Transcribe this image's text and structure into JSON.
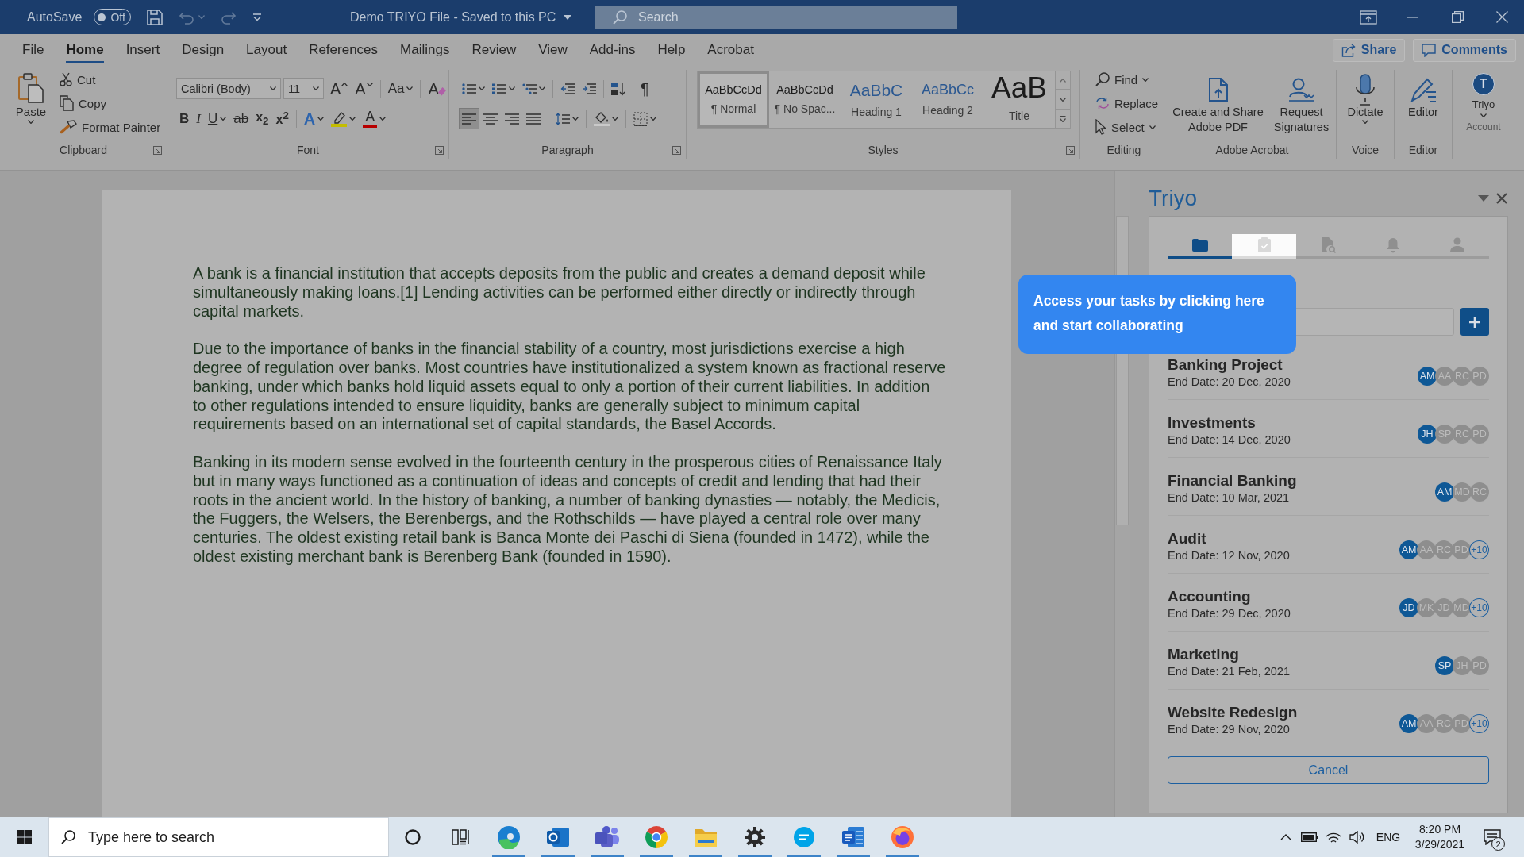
{
  "title_bar": {
    "autosave_label": "AutoSave",
    "autosave_toggle": {
      "on": false,
      "label": "Off"
    },
    "quick_access": [
      {
        "kind": "save",
        "disabled": false
      },
      {
        "kind": "undo",
        "disabled": true,
        "menu": true
      },
      {
        "kind": "redo",
        "disabled": true
      },
      {
        "kind": "customize",
        "disabled": false
      }
    ],
    "document_title": "Demo TRIYO File - Saved to this PC",
    "search": {
      "placeholder": "Search"
    }
  },
  "menu_tabs": [
    {
      "label": "File",
      "selected": false
    },
    {
      "label": "Home",
      "selected": true
    },
    {
      "label": "Insert",
      "selected": false
    },
    {
      "label": "Design",
      "selected": false
    },
    {
      "label": "Layout",
      "selected": false
    },
    {
      "label": "References",
      "selected": false
    },
    {
      "label": "Mailings",
      "selected": false
    },
    {
      "label": "Review",
      "selected": false
    },
    {
      "label": "View",
      "selected": false
    },
    {
      "label": "Add-ins",
      "selected": false
    },
    {
      "label": "Help",
      "selected": false
    },
    {
      "label": "Acrobat",
      "selected": false
    }
  ],
  "share_button": "Share",
  "comments_button": "Comments",
  "ribbon": {
    "groups": [
      {
        "kind": "clipboard",
        "label": "Clipboard",
        "launcher": true,
        "paste": {
          "label": "Paste",
          "menu": true
        },
        "commands": [
          "Cut",
          "Copy",
          "Format Painter"
        ]
      },
      {
        "kind": "font",
        "label": "Font",
        "launcher": true,
        "font_name": "Calibri (Body)",
        "font_size": "11",
        "tools": [
          {
            "kind": "grow",
            "glyph": "A"
          },
          {
            "kind": "shrink",
            "glyph": "A"
          },
          {
            "kind": "case",
            "glyph": "Aa",
            "menu": true
          },
          {
            "kind": "clear",
            "glyph": "A"
          }
        ],
        "formats": [
          {
            "kind": "bold",
            "glyph": "B"
          },
          {
            "kind": "italic",
            "glyph": "I"
          },
          {
            "kind": "underline",
            "glyph": "U",
            "menu": true
          },
          {
            "kind": "strike",
            "glyph": "ab"
          },
          {
            "kind": "subscript",
            "glyph": "x$_{2}$"
          },
          {
            "kind": "superscript",
            "glyph": "x$^{2}$"
          },
          {
            "kind": "effects",
            "glyph": "A",
            "menu": true
          },
          {
            "kind": "highlight",
            "menu": true,
            "color": "#c4bd00"
          },
          {
            "kind": "font_color",
            "glyph": "A",
            "menu": true,
            "color": "#b80000"
          }
        ]
      },
      {
        "kind": "paragraph",
        "label": "Paragraph",
        "launcher": true,
        "row1": [
          {
            "kind": "bullets",
            "menu": true
          },
          {
            "kind": "numbering",
            "menu": true
          },
          {
            "kind": "multilevel",
            "menu": true
          },
          {
            "kind": "decrease_indent"
          },
          {
            "kind": "increase_indent"
          },
          {
            "kind": "sort"
          },
          {
            "kind": "show_marks",
            "glyph": "¶"
          }
        ],
        "alignment": [
          {
            "kind": "align_left",
            "selected": true
          },
          {
            "kind": "align_center",
            "selected": false
          },
          {
            "kind": "align_right",
            "selected": false
          },
          {
            "kind": "align_justify",
            "selected": false
          }
        ],
        "row2": [
          {
            "kind": "line_spacing",
            "menu": true
          },
          {
            "kind": "shading",
            "menu": true
          },
          {
            "kind": "borders",
            "menu": true
          }
        ]
      },
      {
        "kind": "styles",
        "label": "Styles",
        "launcher": true,
        "gallery": [
          {
            "kind": "normal",
            "preview": "AaBbCcDd",
            "name": "¶ Normal",
            "selected": true
          },
          {
            "kind": "no_spacing",
            "preview": "AaBbCcDd",
            "name": "¶ No Spac...",
            "selected": false
          },
          {
            "kind": "heading1",
            "preview": "AaBbC",
            "name": "Heading 1",
            "selected": false
          },
          {
            "kind": "heading2",
            "preview": "AaBbCc",
            "name": "Heading 2",
            "selected": false
          },
          {
            "kind": "title",
            "preview": "AaB",
            "name": "Title",
            "selected": false
          }
        ]
      },
      {
        "kind": "editing",
        "label": "Editing",
        "commands": [
          {
            "kind": "find",
            "label": "Find",
            "menu": true
          },
          {
            "kind": "replace",
            "label": "Replace"
          },
          {
            "kind": "select",
            "label": "Select",
            "menu": true
          }
        ]
      },
      {
        "kind": "big",
        "label": "Adobe Acrobat",
        "commands": [
          {
            "kind": "create_pdf",
            "label": "Create and Share Adobe PDF"
          },
          {
            "kind": "request_signatures",
            "label": "Request Signatures"
          }
        ]
      },
      {
        "kind": "big",
        "label": "Voice",
        "commands": [
          {
            "kind": "dictate",
            "label": "Dictate",
            "menu": true
          }
        ]
      },
      {
        "kind": "big",
        "label": "Editor",
        "commands": [
          {
            "kind": "editor",
            "label": "Editor"
          }
        ]
      },
      {
        "kind": "account",
        "label": "Account",
        "commands": [
          {
            "label": "Triyo",
            "letter": "T",
            "menu": true
          }
        ]
      }
    ]
  },
  "document": {
    "paragraphs": [
      "A bank is a financial institution that accepts deposits from the public and creates a demand deposit while simultaneously making loans.[1] Lending activities can be performed either directly or indirectly through capital markets.",
      "Due to the importance of banks in the financial stability of a country, most jurisdictions exercise a high degree of regulation over banks. Most countries have institutionalized a system known as fractional reserve banking, under which banks hold liquid assets equal to only a portion of their current liabilities. In addition to other regulations intended to ensure liquidity, banks are generally subject to minimum capital requirements based on an international set of capital standards, the Basel Accords.",
      "Banking in its modern sense evolved in the fourteenth century in the prosperous cities of Renaissance Italy but in many ways functioned as a continuation of ideas and concepts of credit and lending that had their roots in the ancient world. In the history of banking, a number of banking dynasties — notably, the Medicis, the Fuggers, the Welsers, the Berenbergs, and the Rothschilds — have played a central role over many centuries. The oldest existing retail bank is Banca Monte dei Paschi di Siena (founded in 1472), while the oldest existing merchant bank is Berenberg Bank (founded in 1590)."
    ]
  },
  "triyo_pane": {
    "title": "Triyo",
    "tabs": [
      {
        "kind": "projects",
        "selected": true,
        "spotlight": false
      },
      {
        "kind": "tasks",
        "selected": false,
        "spotlight": true
      },
      {
        "kind": "documents",
        "selected": false,
        "spotlight": false
      },
      {
        "kind": "notifications",
        "selected": false,
        "spotlight": false
      },
      {
        "kind": "profile",
        "selected": false,
        "spotlight": false
      }
    ],
    "projects": [
      {
        "name": "Banking Project",
        "end_date": "End Date: 20 Dec, 2020",
        "members": [
          {
            "initials": "AM",
            "color": "#0e5896"
          },
          {
            "initials": "AA",
            "color": "#8e8e8e"
          },
          {
            "initials": "RC",
            "color": "#8e8e8e"
          },
          {
            "initials": "PD",
            "color": "#8e8e8e"
          }
        ]
      },
      {
        "name": "Investments",
        "end_date": "End Date: 14 Dec, 2020",
        "members": [
          {
            "initials": "JH",
            "color": "#0e5896"
          },
          {
            "initials": "SP",
            "color": "#8e8e8e"
          },
          {
            "initials": "RC",
            "color": "#8e8e8e"
          },
          {
            "initials": "PD",
            "color": "#8e8e8e"
          }
        ]
      },
      {
        "name": "Financial Banking",
        "end_date": "End Date: 10 Mar, 2021",
        "members": [
          {
            "initials": "AM",
            "color": "#0e5896"
          },
          {
            "initials": "MD",
            "color": "#8e8e8e"
          },
          {
            "initials": "RC",
            "color": "#8e8e8e"
          }
        ]
      },
      {
        "name": "Audit",
        "end_date": "End Date: 12 Nov, 2020",
        "members": [
          {
            "initials": "AM",
            "color": "#0e5896"
          },
          {
            "initials": "AA",
            "color": "#8e8e8e"
          },
          {
            "initials": "RC",
            "color": "#8e8e8e"
          },
          {
            "initials": "PD",
            "color": "#8e8e8e"
          }
        ],
        "more": "+10"
      },
      {
        "name": "Accounting",
        "end_date": "End Date: 29 Dec, 2020",
        "members": [
          {
            "initials": "JD",
            "color": "#0e5896"
          },
          {
            "initials": "MK",
            "color": "#8e8e8e"
          },
          {
            "initials": "JD",
            "color": "#8e8e8e"
          },
          {
            "initials": "MD",
            "color": "#8e8e8e"
          }
        ],
        "more": "+10"
      },
      {
        "name": "Marketing",
        "end_date": "End Date: 21 Feb, 2021",
        "members": [
          {
            "initials": "SP",
            "color": "#0e5896"
          },
          {
            "initials": "JH",
            "color": "#8e8e8e"
          },
          {
            "initials": "PD",
            "color": "#8e8e8e"
          }
        ]
      },
      {
        "name": "Website Redesign",
        "end_date": "End Date: 29 Nov, 2020",
        "members": [
          {
            "initials": "AM",
            "color": "#0e5896"
          },
          {
            "initials": "AA",
            "color": "#8e8e8e"
          },
          {
            "initials": "RC",
            "color": "#8e8e8e"
          },
          {
            "initials": "PD",
            "color": "#8e8e8e"
          }
        ],
        "more": "+10"
      }
    ],
    "cancel_button": "Cancel"
  },
  "tooltip": {
    "text": "Access your tasks by clicking here and start collaborating"
  },
  "taskbar": {
    "search": {
      "placeholder": "Type here to search"
    },
    "apps": [
      {
        "kind": "edge",
        "running": true
      },
      {
        "kind": "outlook",
        "running": true
      },
      {
        "kind": "teams",
        "running": true
      },
      {
        "kind": "chrome",
        "running": true
      },
      {
        "kind": "explorer",
        "running": true
      },
      {
        "kind": "settings",
        "running": true
      },
      {
        "kind": "skype",
        "running": true
      },
      {
        "kind": "word",
        "running": true
      },
      {
        "kind": "firefox",
        "running": true
      }
    ],
    "tray": {
      "language": "ENG",
      "time": "8:20 PM",
      "date": "3/29/2021",
      "notification_count": "2"
    }
  }
}
